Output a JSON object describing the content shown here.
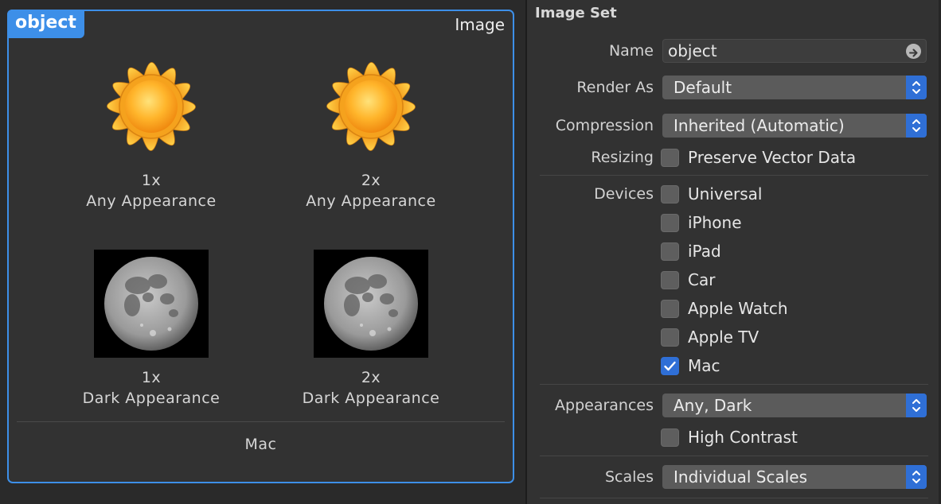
{
  "image_set": {
    "name_tag": "object",
    "kind": "Image",
    "slots": [
      {
        "scale": "1x",
        "appearance": "Any Appearance",
        "image": "sun-image"
      },
      {
        "scale": "2x",
        "appearance": "Any Appearance",
        "image": "sun-image"
      },
      {
        "scale": "1x",
        "appearance": "Dark Appearance",
        "image": "moon-image"
      },
      {
        "scale": "2x",
        "appearance": "Dark Appearance",
        "image": "moon-image"
      }
    ],
    "platform": "Mac"
  },
  "inspector": {
    "title": "Image Set",
    "name": {
      "label": "Name",
      "value": "object"
    },
    "render_as": {
      "label": "Render As",
      "value": "Default"
    },
    "compression": {
      "label": "Compression",
      "value": "Inherited (Automatic)"
    },
    "resizing": {
      "label": "Resizing",
      "option": "Preserve Vector Data",
      "checked": false
    },
    "devices": {
      "label": "Devices",
      "items": [
        {
          "label": "Universal",
          "checked": false
        },
        {
          "label": "iPhone",
          "checked": false
        },
        {
          "label": "iPad",
          "checked": false
        },
        {
          "label": "Car",
          "checked": false
        },
        {
          "label": "Apple Watch",
          "checked": false
        },
        {
          "label": "Apple TV",
          "checked": false
        },
        {
          "label": "Mac",
          "checked": true
        }
      ]
    },
    "appearances": {
      "label": "Appearances",
      "value": "Any, Dark",
      "high_contrast": "High Contrast",
      "high_contrast_checked": false
    },
    "scales": {
      "label": "Scales",
      "value": "Individual Scales"
    }
  },
  "colors": {
    "accent": "#3d8fe8",
    "checkbox_on": "#2f6fd6",
    "panel": "#323232"
  }
}
